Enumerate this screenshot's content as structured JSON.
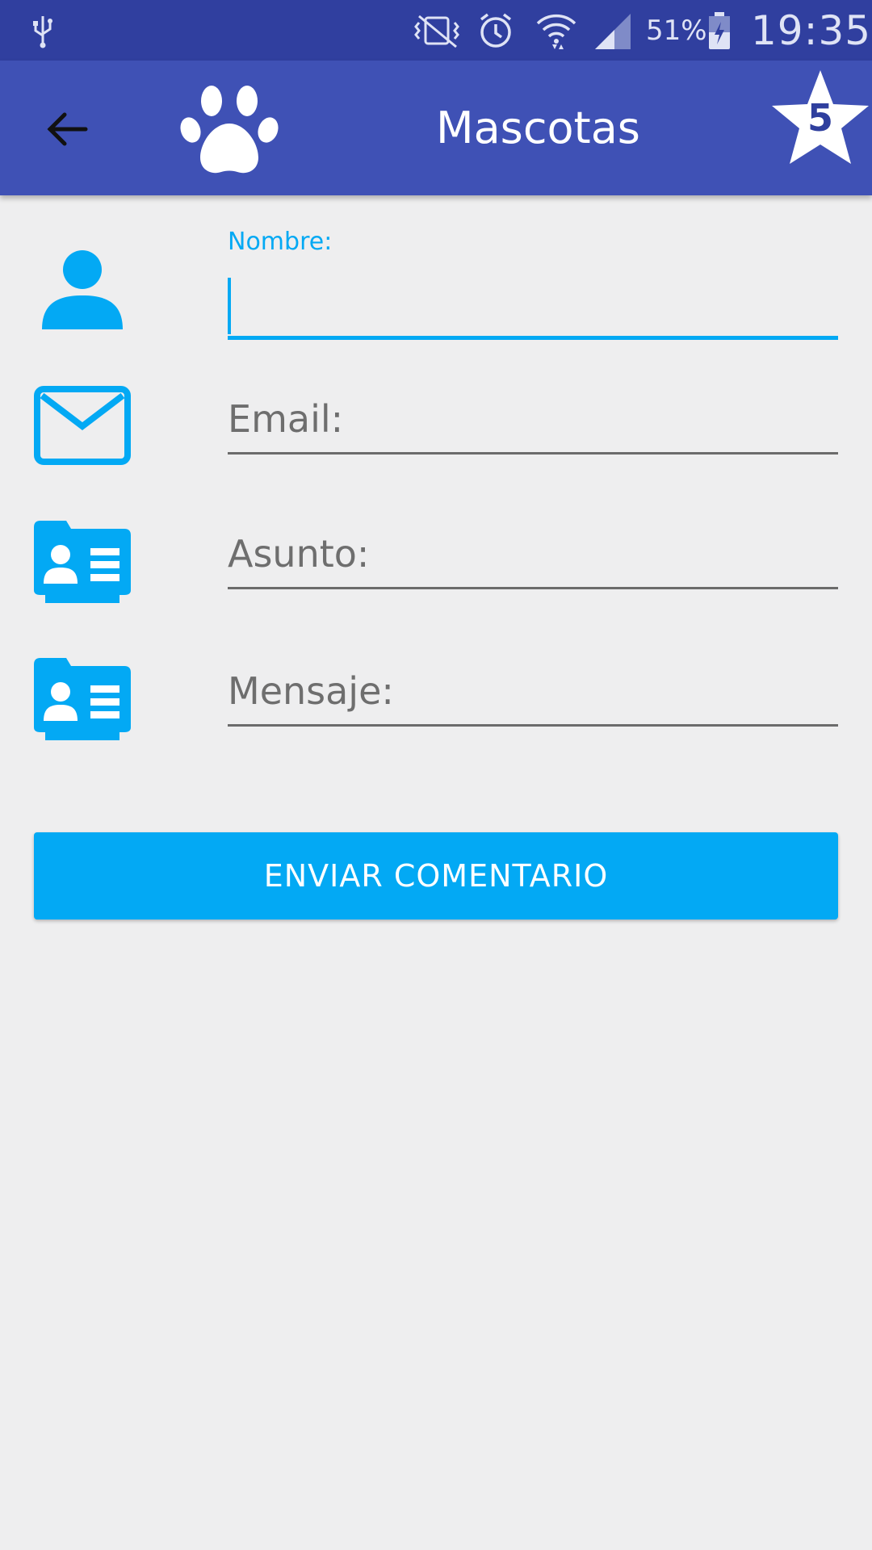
{
  "status_bar": {
    "icons": [
      "usb-icon",
      "mute-vibrate-icon",
      "alarm-icon",
      "wifi-icon",
      "signal-icon",
      "battery-charging-icon"
    ],
    "battery_percent": "51%",
    "time": "19:35"
  },
  "app_bar": {
    "title": "Mascotas",
    "back_icon": "arrow-back-icon",
    "logo_icon": "paw-icon",
    "badge_count": "5",
    "colors": {
      "status_bar": "#303f9f",
      "app_bar": "#3f51b5"
    }
  },
  "form": {
    "fields": [
      {
        "id": "nombre",
        "label": "Nombre:",
        "value": "",
        "icon": "person-icon",
        "focused": true
      },
      {
        "id": "email",
        "placeholder": "Email:",
        "value": "",
        "icon": "mail-icon"
      },
      {
        "id": "asunto",
        "placeholder": "Asunto:",
        "value": "",
        "icon": "contact-card-icon"
      },
      {
        "id": "mensaje",
        "placeholder": "Mensaje:",
        "value": "",
        "icon": "contact-card-icon"
      }
    ],
    "submit_label": "ENVIAR COMENTARIO",
    "accent_color": "#03a9f4"
  }
}
